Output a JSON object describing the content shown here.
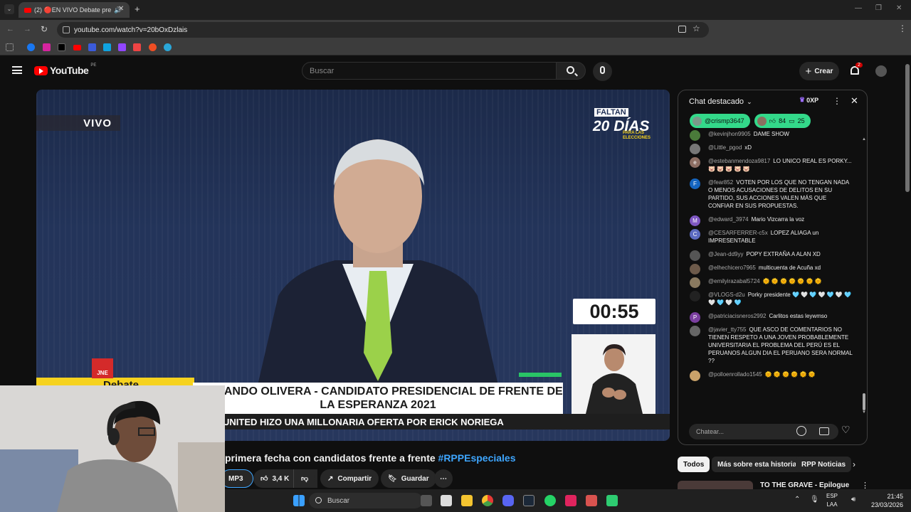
{
  "browser": {
    "tab_title": "(2) 🔴EN VIVO Debate pre",
    "url": "youtube.com/watch?v=20bOxDzlais"
  },
  "youtube": {
    "logo_text": "YouTube",
    "logo_region": "PE",
    "search_placeholder": "Buscar",
    "create_label": "Crear",
    "notifications_count": "2"
  },
  "video": {
    "live_badge": "VIVO",
    "countdown_faltan": "FALTAN",
    "countdown_days": "20 DÍAS",
    "countdown_sub": "PARA LAS ELECCIONES",
    "timer": "00:55",
    "jne_logo": "JNE",
    "jne_bar_text": "Debate",
    "lower_third": "FERNANDO OLIVERA - CANDIDATO PRESIDENCIAL DE FRENTE DE LA ESPERANZA 2021",
    "ticker": "UNITED HIZO UNA MILLONARIA OFERTA POR ERICK NORIEGA",
    "title_text": "primera fecha con candidatos frente a frente",
    "title_tag": "#RPPEspeciales"
  },
  "actions": {
    "mp3_label": "MP3",
    "likes": "3,4 K",
    "share_label": "Compartir",
    "save_label": "Guardar"
  },
  "chat": {
    "header": "Chat destacado",
    "xp_badge": "0XP",
    "pinned_user": "@crismp3647",
    "likes": "84",
    "comments": "25",
    "input_placeholder": "Chatear...",
    "messages": [
      {
        "author": "@kevinjhon9905",
        "text": "DAME SHOW",
        "initial": "",
        "color": "#4a7a3a"
      },
      {
        "author": "@Little_pgod",
        "text": "xD",
        "initial": "",
        "color": "#777"
      },
      {
        "author": "@estebanmendoza9817",
        "text": "LO UNICO REAL ES PORKY... 🐷 🐷 🐷 🐷 🐷",
        "initial": "e",
        "color": "#8d6e63"
      },
      {
        "author": "@fear852",
        "text": "VOTEN POR LOS QUE NO TENGAN NADA O MENOS ACUSACIONES DE DELITOS EN SU PARTIDO, SUS ACCIONES VALEN MÁS QUE CONFIAR EN SUS PROPUESTAS.",
        "initial": "F",
        "color": "#1565c0"
      },
      {
        "author": "@edward_3974",
        "text": "Mario Vizcarra la voz",
        "initial": "M",
        "color": "#7e57c2"
      },
      {
        "author": "@CESARFERRER-c5x",
        "text": "LOPEZ ALIAGA un IMPRESENTABLE",
        "initial": "C",
        "color": "#5c6bc0"
      },
      {
        "author": "@Jean-dd9yy",
        "text": "POPY EXTRAÑA A ALAN XD",
        "initial": "",
        "color": "#555"
      },
      {
        "author": "@elhechicero7965",
        "text": "multicuenta de Acuña xd",
        "initial": "",
        "color": "#6d5a4a"
      },
      {
        "author": "@emilyirazabal5724",
        "text": "🌞 🌞 🌞 🌞 🌞 🌞 🌞",
        "initial": "",
        "color": "#8a7a60"
      },
      {
        "author": "@VLOGS-d2u",
        "text": "Porky presidente 🩵 🤍 🩵 🤍 🩵 🤍 🩵 🤍 🩵 🤍 🩵",
        "initial": "",
        "color": "#222"
      },
      {
        "author": "@patriciacisneros2992",
        "text": "Carlitos estas leywmso",
        "initial": "P",
        "color": "#7b3fa0"
      },
      {
        "author": "@javier_tty755",
        "text": "QUE ASCO DE COMENTARIOS NO TIENEN RESPETO A UNA JOVEN PROBABLEMENTE UNIVERSITARIA EL PROBLEMA DEL PERÚ ES EL PERUANOS ALGUN DIA EL PERUANO SERA NORMAL ??",
        "initial": "",
        "color": "#666"
      },
      {
        "author": "@polloenrollado1545",
        "text": "🌞 🌞 🌞 🌞 🌞 🌞",
        "initial": "",
        "color": "#c9a26a"
      }
    ]
  },
  "chips": [
    "Todos",
    "Más sobre esta historia",
    "RPP Noticias"
  ],
  "next_video_title": "TO THE GRAVE - Epilogue",
  "taskbar": {
    "search_label": "Buscar",
    "lang": "ESP",
    "lang_sub": "LAA",
    "time": "21:45",
    "date": "23/03/2026"
  },
  "colors": {
    "accent_blue": "#3ea6ff",
    "chat_pill": "#33d98a",
    "live_red": "#ff0000"
  }
}
